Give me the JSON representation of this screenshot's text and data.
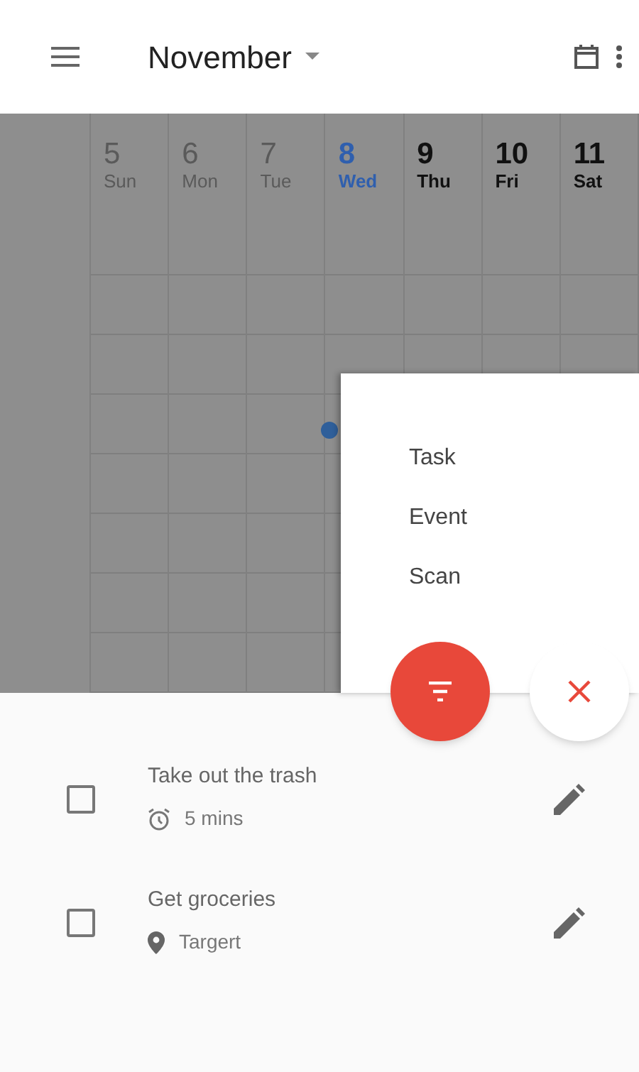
{
  "app_bar": {
    "title": "November"
  },
  "days": [
    {
      "number": "5",
      "weekday": "Sun",
      "past": true,
      "selected": false
    },
    {
      "number": "6",
      "weekday": "Mon",
      "past": true,
      "selected": false
    },
    {
      "number": "7",
      "weekday": "Tue",
      "past": true,
      "selected": false
    },
    {
      "number": "8",
      "weekday": "Wed",
      "past": false,
      "selected": true
    },
    {
      "number": "9",
      "weekday": "Thu",
      "past": false,
      "selected": false
    },
    {
      "number": "10",
      "weekday": "Fri",
      "past": false,
      "selected": false
    },
    {
      "number": "11",
      "weekday": "Sat",
      "past": false,
      "selected": false
    }
  ],
  "add_menu": {
    "items": [
      "Task",
      "Event",
      "Scan"
    ]
  },
  "tasks": [
    {
      "title": "Take out the trash",
      "detail": "5 mins",
      "kind": "duration",
      "checked": false
    },
    {
      "title": "Get groceries",
      "detail": "Targert",
      "kind": "location",
      "checked": false
    }
  ]
}
